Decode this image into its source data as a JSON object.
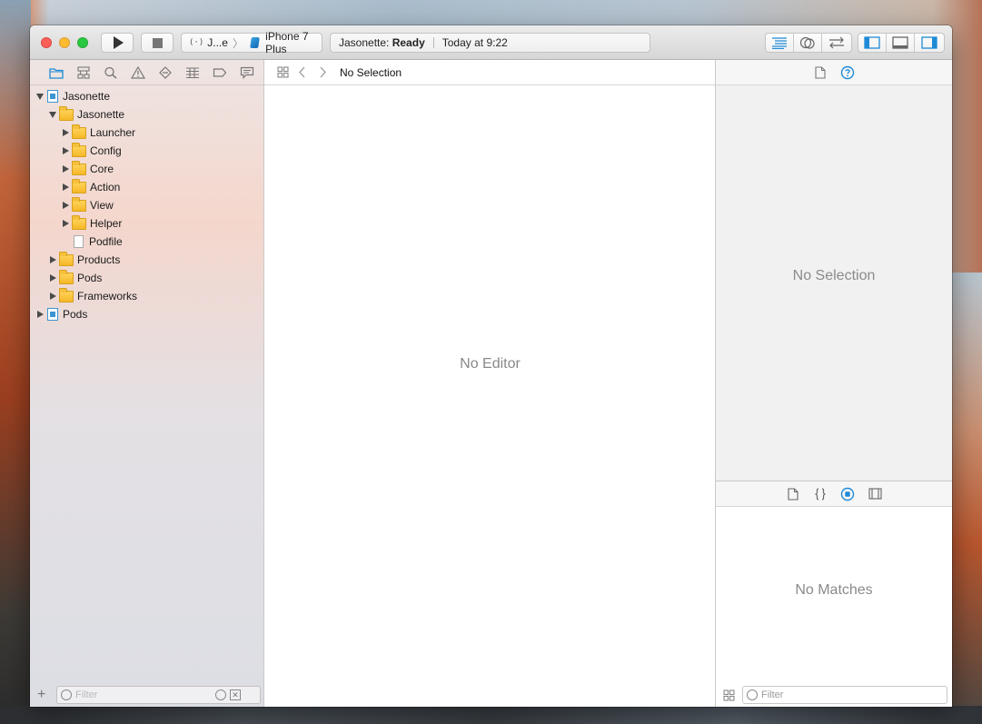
{
  "colors": {
    "accent": "#1f8ad6",
    "folder": "#f5b827",
    "close": "#fc5f57",
    "minimize": "#fdbc2e",
    "zoom": "#28c840"
  },
  "toolbar": {
    "scheme": {
      "icon": "target-icon",
      "target_label": "J...e",
      "device_label": "iPhone 7 Plus"
    },
    "activity": {
      "project": "Jasonette:",
      "status": "Ready",
      "time": "Today at 9:22"
    }
  },
  "navigator": {
    "tabs": [
      "project",
      "symbol",
      "find",
      "issue",
      "test",
      "debug",
      "breakpoint",
      "report"
    ],
    "tree": [
      {
        "label": "Jasonette",
        "kind": "project",
        "depth": 0,
        "state": "expanded"
      },
      {
        "label": "Jasonette",
        "kind": "folder",
        "depth": 1,
        "state": "expanded"
      },
      {
        "label": "Launcher",
        "kind": "folder",
        "depth": 2,
        "state": "collapsed"
      },
      {
        "label": "Config",
        "kind": "folder",
        "depth": 2,
        "state": "collapsed"
      },
      {
        "label": "Core",
        "kind": "folder",
        "depth": 2,
        "state": "collapsed"
      },
      {
        "label": "Action",
        "kind": "folder",
        "depth": 2,
        "state": "collapsed"
      },
      {
        "label": "View",
        "kind": "folder",
        "depth": 2,
        "state": "collapsed"
      },
      {
        "label": "Helper",
        "kind": "folder",
        "depth": 2,
        "state": "collapsed"
      },
      {
        "label": "Podfile",
        "kind": "file",
        "depth": 2,
        "state": "leaf"
      },
      {
        "label": "Products",
        "kind": "folder",
        "depth": 1,
        "state": "collapsed"
      },
      {
        "label": "Pods",
        "kind": "folder",
        "depth": 1,
        "state": "collapsed"
      },
      {
        "label": "Frameworks",
        "kind": "folder",
        "depth": 1,
        "state": "collapsed"
      },
      {
        "label": "Pods",
        "kind": "project",
        "depth": 0,
        "state": "collapsed"
      }
    ],
    "filter_placeholder": "Filter"
  },
  "editor": {
    "jumpbar_crumb": "No Selection",
    "empty_text": "No Editor"
  },
  "inspector": {
    "empty_text": "No Selection"
  },
  "library": {
    "empty_text": "No Matches",
    "filter_placeholder": "Filter"
  }
}
